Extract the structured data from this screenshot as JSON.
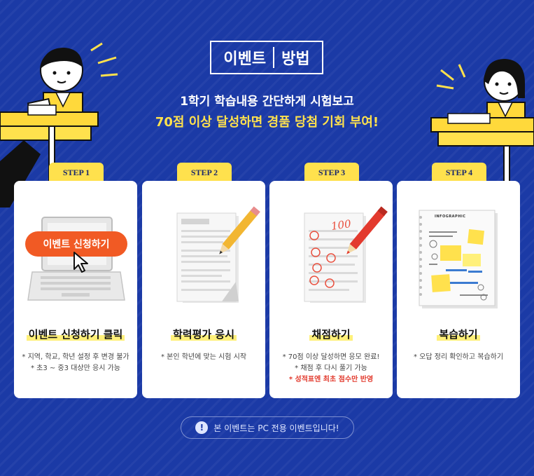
{
  "header": {
    "title_left": "이벤트",
    "title_right": "방법",
    "line1": "1학기 학습내용 간단하게 시험보고",
    "line2": "70점 이상 달성하면  경품 당첨 기회 부여!"
  },
  "steps": [
    {
      "tab": "STEP 1",
      "title": "이벤트 신청하기 클릭",
      "button": "이벤트 신청하기",
      "desc1": "* 지역, 학교, 학년 설정 후 변경 불가",
      "desc2": "* 초3 ~ 중3 대상만 응시 가능"
    },
    {
      "tab": "STEP 2",
      "title": "학력평가 응시",
      "desc1": "* 본인 학년에 맞는 시험 시작"
    },
    {
      "tab": "STEP 3",
      "title": "채점하기",
      "score": "100",
      "desc1": "* 70점 이상 달성하면 응모 완료!",
      "desc2": "* 채점 후 다시 풀기 가능",
      "desc3": "* 성적표엔 최초 점수만 반영"
    },
    {
      "tab": "STEP 4",
      "title": "복습하기",
      "poster_title": "INFOGRAPHIC",
      "desc1": "* 오답 정리 확인하고 복습하기"
    }
  ],
  "notice": {
    "icon": "exclamation-icon",
    "text": "본 이벤트는 PC 전용 이벤트입니다!"
  },
  "colors": {
    "background": "#1b3aa6",
    "accent_yellow": "#ffe14d",
    "button_orange": "#f15a24",
    "red_text": "#e23b2e"
  }
}
